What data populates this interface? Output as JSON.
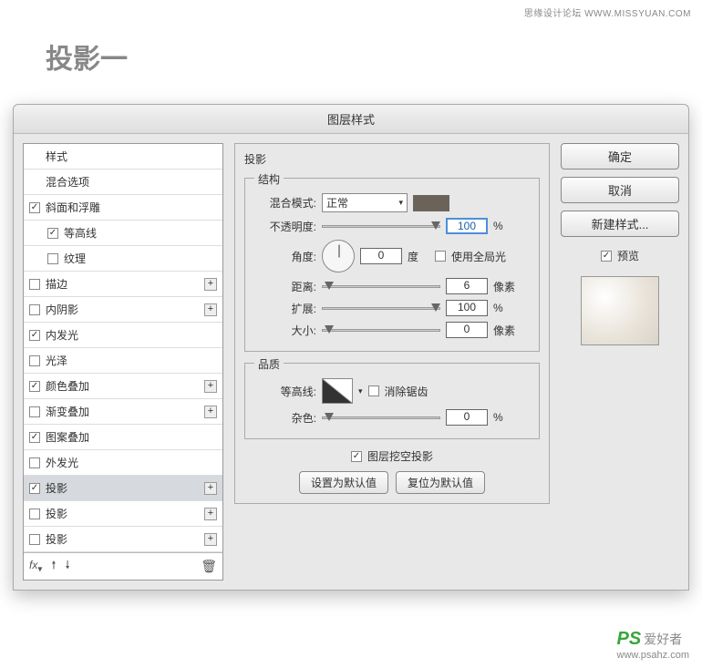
{
  "watermark_top": "思缘设计论坛   WWW.MISSYUAN.COM",
  "page_title": "投影一",
  "dialog": {
    "title": "图层样式"
  },
  "styles_list": {
    "header1": "样式",
    "header2": "混合选项",
    "items": [
      {
        "label": "斜面和浮雕",
        "checked": true,
        "plus": false,
        "indent": 0
      },
      {
        "label": "等高线",
        "checked": true,
        "plus": false,
        "indent": 1
      },
      {
        "label": "纹理",
        "checked": false,
        "plus": false,
        "indent": 1
      },
      {
        "label": "描边",
        "checked": false,
        "plus": true,
        "indent": 0
      },
      {
        "label": "内阴影",
        "checked": false,
        "plus": true,
        "indent": 0
      },
      {
        "label": "内发光",
        "checked": true,
        "plus": false,
        "indent": 0
      },
      {
        "label": "光泽",
        "checked": false,
        "plus": false,
        "indent": 0
      },
      {
        "label": "颜色叠加",
        "checked": true,
        "plus": true,
        "indent": 0
      },
      {
        "label": "渐变叠加",
        "checked": false,
        "plus": true,
        "indent": 0
      },
      {
        "label": "图案叠加",
        "checked": true,
        "plus": false,
        "indent": 0
      },
      {
        "label": "外发光",
        "checked": false,
        "plus": false,
        "indent": 0
      },
      {
        "label": "投影",
        "checked": true,
        "plus": true,
        "indent": 0,
        "selected": true
      },
      {
        "label": "投影",
        "checked": false,
        "plus": true,
        "indent": 0
      },
      {
        "label": "投影",
        "checked": false,
        "plus": true,
        "indent": 0
      }
    ],
    "footer_fx": "fx"
  },
  "center": {
    "section_title": "投影",
    "structure": {
      "title": "结构",
      "blend_mode_label": "混合模式:",
      "blend_mode_value": "正常",
      "opacity_label": "不透明度:",
      "opacity_value": "100",
      "opacity_unit": "%",
      "angle_label": "角度:",
      "angle_value": "0",
      "angle_unit": "度",
      "global_light_label": "使用全局光",
      "distance_label": "距离:",
      "distance_value": "6",
      "distance_unit": "像素",
      "spread_label": "扩展:",
      "spread_value": "100",
      "spread_unit": "%",
      "size_label": "大小:",
      "size_value": "0",
      "size_unit": "像素"
    },
    "quality": {
      "title": "品质",
      "contour_label": "等高线:",
      "antialias_label": "消除锯齿",
      "noise_label": "杂色:",
      "noise_value": "0",
      "noise_unit": "%"
    },
    "knockout_label": "图层挖空投影",
    "make_default_btn": "设置为默认值",
    "reset_default_btn": "复位为默认值"
  },
  "right": {
    "ok": "确定",
    "cancel": "取消",
    "new_style": "新建样式...",
    "preview_label": "预览"
  },
  "footer": {
    "ps": "PS",
    "ah": "爱好者",
    "url": "www.psahz.com"
  },
  "slider_positions": {
    "opacity": "92%",
    "distance": "2%",
    "spread": "92%",
    "size": "2%",
    "noise": "2%"
  }
}
